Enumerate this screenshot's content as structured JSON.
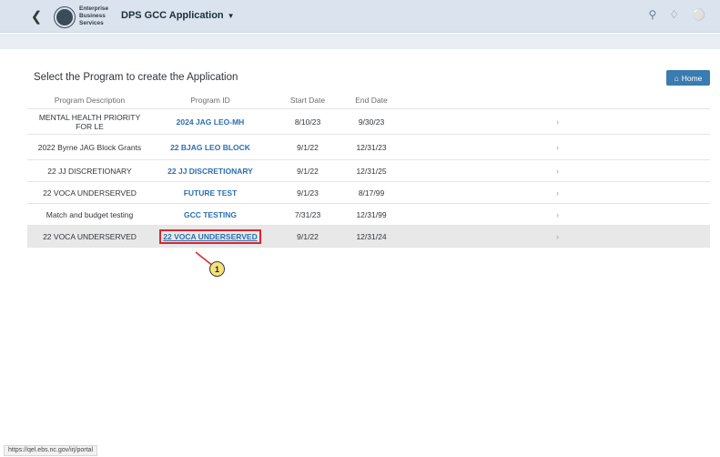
{
  "shell": {
    "back_icon": "chevron-left-icon",
    "logo_line1": "Enterprise",
    "logo_line2": "Business",
    "logo_line3": "Services",
    "app_title": "DPS GCC Application",
    "icons": [
      "search-icon",
      "bell-icon",
      "user-icon"
    ]
  },
  "page": {
    "heading": "Select the Program to create the Application",
    "home_label": "Home"
  },
  "table": {
    "columns": [
      "Program Description",
      "Program ID",
      "Start Date",
      "End Date"
    ],
    "rows": [
      {
        "description": "MENTAL HEALTH PRIORITY FOR LE",
        "program_id": "2024 JAG LEO-MH",
        "start": "8/10/23",
        "end": "9/30/23"
      },
      {
        "description": "2022 Byrne JAG Block Grants",
        "program_id": "22 BJAG LEO BLOCK",
        "start": "9/1/22",
        "end": "12/31/23"
      },
      {
        "description": "22 JJ DISCRETIONARY",
        "program_id": "22 JJ DISCRETIONARY",
        "start": "9/1/22",
        "end": "12/31/25"
      },
      {
        "description": "22 VOCA UNDERSERVED",
        "program_id": "FUTURE TEST",
        "start": "9/1/23",
        "end": "8/17/99"
      },
      {
        "description": "Match and budget testing",
        "program_id": "GCC TESTING",
        "start": "7/31/23",
        "end": "12/31/99"
      },
      {
        "description": "22 VOCA UNDERSERVED",
        "program_id": "22 VOCA UNDERSERVED",
        "start": "9/1/22",
        "end": "12/31/24"
      }
    ]
  },
  "callout": {
    "number": "1"
  },
  "status_url": "https://qel.ebs.nc.gov/irj/portal"
}
